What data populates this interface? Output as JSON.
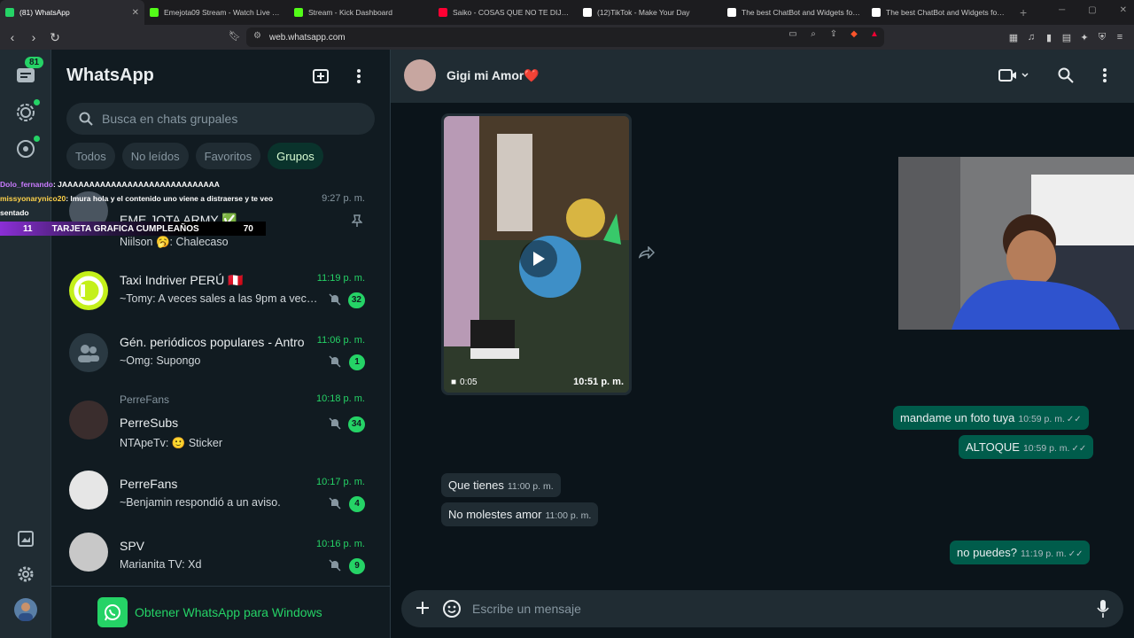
{
  "browser": {
    "tabs": [
      {
        "title": "(81) WhatsApp",
        "color": "#25d366",
        "active": true
      },
      {
        "title": "Emejota09 Stream - Watch Live on Kick",
        "color": "#53fc18"
      },
      {
        "title": "Stream - Kick Dashboard",
        "color": "#53fc18"
      },
      {
        "title": "Saiko - COSAS QUE NO TE DIJE (Offi",
        "color": "#ff0033"
      },
      {
        "title": "(12)TikTok - Make Your Day",
        "color": "#ffffff"
      },
      {
        "title": "The best ChatBot and Widgets for K",
        "color": "#ffffff"
      },
      {
        "title": "The best ChatBot and Widgets for K",
        "color": "#ffffff"
      }
    ],
    "url": "web.whatsapp.com",
    "new_tab": "+"
  },
  "rail": {
    "chats_badge": "81"
  },
  "sidebar": {
    "title": "WhatsApp",
    "search_placeholder": "Busca en chats grupales",
    "filters": [
      "Todos",
      "No leídos",
      "Favoritos",
      "Grupos"
    ],
    "active_filter": "Grupos",
    "chats": [
      {
        "name": "EME JOTA ARMY ✅",
        "group": "",
        "message": "Niilson 🥱: Chalecaso",
        "time": "9:27 p. m.",
        "badge": "",
        "pinned": true,
        "muted": false
      },
      {
        "name": "Taxi Indriver PERÚ 🇵🇪",
        "group": "",
        "message": "~Tomy: A veces sales a las 9pm a vece...",
        "time": "11:19 p. m.",
        "badge": "32",
        "pinned": false,
        "muted": true
      },
      {
        "name": "Gén. periódicos populares - Antro",
        "group": "",
        "message": "~Omg: Supongo",
        "time": "11:06 p. m.",
        "badge": "1",
        "pinned": false,
        "muted": true
      },
      {
        "name": "PerreSubs",
        "group": "PerreFans",
        "message": "NTApeTv: 🙂 Sticker",
        "time": "10:18 p. m.",
        "badge": "34",
        "pinned": false,
        "muted": true
      },
      {
        "name": "PerreFans",
        "group": "",
        "message": "~Benjamin respondió a un aviso.",
        "time": "10:17 p. m.",
        "badge": "4",
        "pinned": false,
        "muted": true
      },
      {
        "name": "SPV",
        "group": "",
        "message": "Marianita TV: Xd",
        "time": "10:16 p. m.",
        "badge": "9",
        "pinned": false,
        "muted": true
      }
    ],
    "get_app": "Obtener WhatsApp para Windows"
  },
  "conversation": {
    "contact": "Gigi mi Amor❤️",
    "video": {
      "duration": "0:05",
      "time": "10:51 p. m."
    },
    "messages": [
      {
        "dir": "out",
        "text": "mandame un foto tuya",
        "time": "10:59 p. m."
      },
      {
        "dir": "out",
        "text": "ALTOQUE",
        "time": "10:59 p. m."
      },
      {
        "dir": "in",
        "text": "Que tienes",
        "time": "11:00 p. m."
      },
      {
        "dir": "in",
        "text": "No molestes amor",
        "time": "11:00 p. m."
      },
      {
        "dir": "out",
        "text": "no puedes?",
        "time": "11:19 p. m."
      }
    ],
    "composer_placeholder": "Escribe un mensaje"
  },
  "overlay": {
    "chat_lines": [
      {
        "user": "Dolo_fernando",
        "text": ": JAAAAAAAAAAAAAAAAAAAAAAAAAAAAA"
      },
      {
        "user": "missyonarynico20",
        "text": ": lmura hola y el contenido uno viene a distraerse y te veo sentado"
      }
    ],
    "bar_left": "11",
    "bar_label": "TARJETA GRAFICA CUMPLEAÑOS",
    "bar_right": "70"
  },
  "colors": {
    "accent": "#25d366",
    "outgoing": "#005c4b",
    "incoming": "#202c33"
  }
}
